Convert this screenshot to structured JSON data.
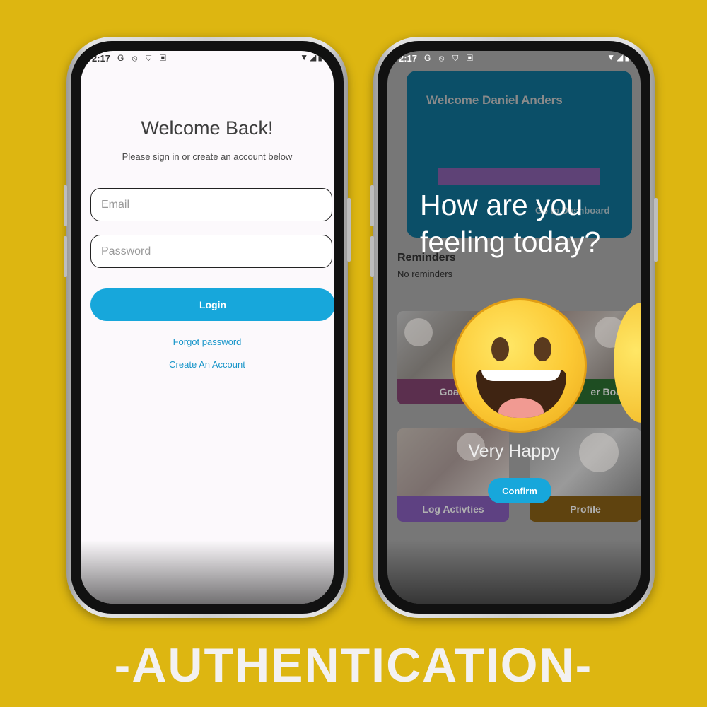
{
  "login_screen": {
    "status_time": "2:17",
    "status_icons": "G ⦸ ⛉ ▣",
    "status_right": "▼◢▮",
    "title": "Welcome Back!",
    "subtitle": "Please sign in or create an account below",
    "email_placeholder": "Email",
    "password_placeholder": "Password",
    "login_label": "Login",
    "forgot_label": "Forgot password",
    "create_account_label": "Create An Account"
  },
  "dashboard_screen": {
    "status_time": "2:17",
    "status_icons": "G ⦸ ⛉ ▣",
    "status_right": "▼◢▮",
    "welcome_text": "Welcome Daniel Anders",
    "go_dashboard_label": "Go to Dashboard",
    "reminders_title": "Reminders",
    "reminders_text": "No reminders",
    "tiles": [
      {
        "label": "Goals"
      },
      {
        "label": "er Board"
      },
      {
        "label": "Log Activties"
      },
      {
        "label": "Profile"
      }
    ]
  },
  "mood_dialog": {
    "question": "How are you feeling today?",
    "emoji": "grinning-face-icon",
    "mood_label": "Very Happy",
    "confirm_label": "Confirm"
  },
  "banner": {
    "text": "-AUTHENTICATION-"
  },
  "colors": {
    "background": "#DDB611",
    "accent": "#17A7DB",
    "card": "#0B4F68"
  }
}
